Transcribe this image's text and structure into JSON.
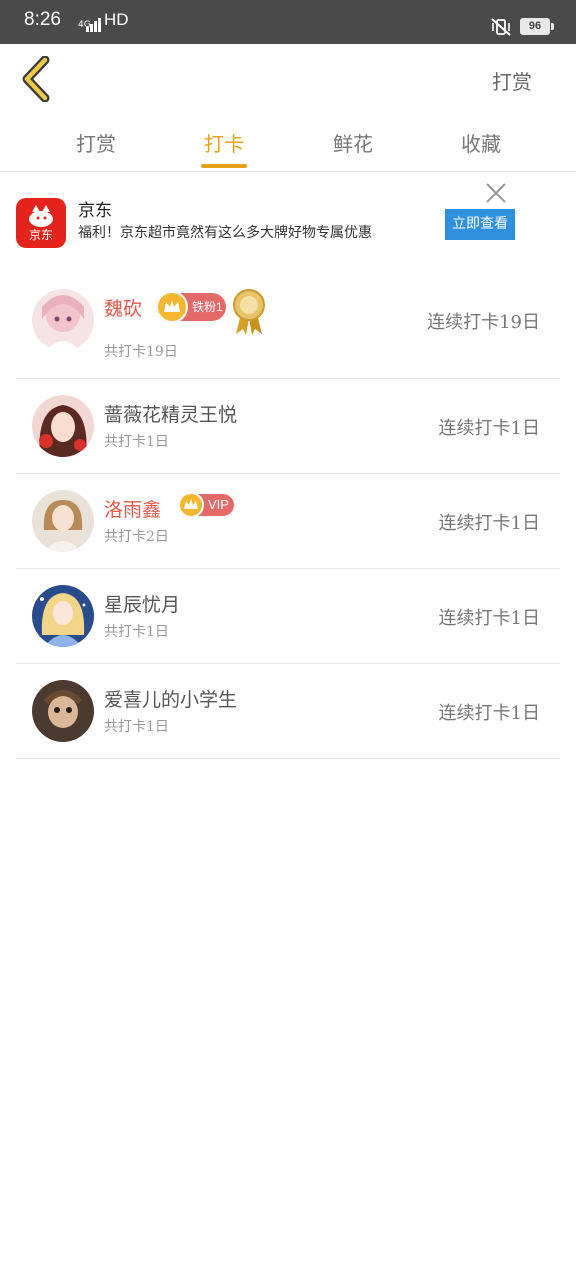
{
  "status_bar": {
    "time": "8:26",
    "network": "4G",
    "hd": "HD",
    "battery": "96"
  },
  "header": {
    "action_label": "打赏"
  },
  "tabs": [
    {
      "label": "打赏"
    },
    {
      "label": "打卡"
    },
    {
      "label": "鲜花"
    },
    {
      "label": "收藏"
    }
  ],
  "active_tab": "打卡",
  "ad": {
    "brand_logo_text": "京东",
    "title": "京东",
    "description": "福利！京东超市竟然有这么多大牌好物专属优惠",
    "cta_label": "立即查看"
  },
  "checkins": [
    {
      "name": "魏砍",
      "total": "共打卡19日",
      "streak": "连续打卡19日",
      "badge_text": "铁粉1",
      "has_medal": true,
      "highlight": true
    },
    {
      "name": "蔷薇花精灵王悦",
      "total": "共打卡1日",
      "streak": "连续打卡1日"
    },
    {
      "name": "洛雨鑫",
      "total": "共打卡2日",
      "streak": "连续打卡1日",
      "vip_text": "VIP",
      "highlight": true
    },
    {
      "name": "星辰忧月",
      "total": "共打卡1日",
      "streak": "连续打卡1日"
    },
    {
      "name": "爱喜儿的小学生",
      "total": "共打卡1日",
      "streak": "连续打卡1日"
    }
  ],
  "colors": {
    "accent": "#e3a21a",
    "vip_name": "#e05a4a",
    "ad_button": "#2f8fe0",
    "jd_red": "#e4241c"
  }
}
